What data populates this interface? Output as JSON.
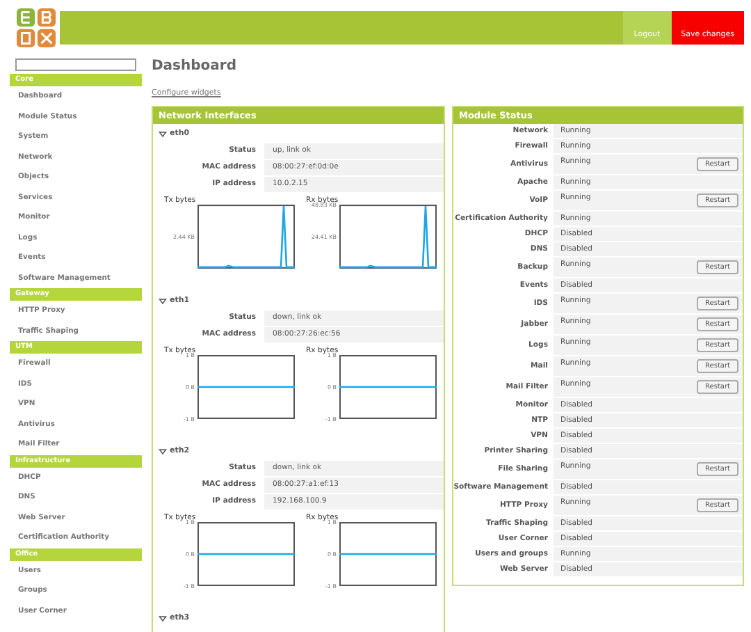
{
  "header": {
    "buttons": [
      {
        "label": "Logout",
        "kind": "plain"
      },
      {
        "label": "Save changes",
        "kind": "alert"
      }
    ]
  },
  "sidebar": {
    "sections": [
      {
        "title": "Core",
        "items": [
          "Dashboard",
          "Module Status",
          "System",
          "Network",
          "Objects",
          "Services",
          "Monitor",
          "Logs",
          "Events",
          "Software Management"
        ]
      },
      {
        "title": "Gateway",
        "items": [
          "HTTP Proxy",
          "Traffic Shaping"
        ]
      },
      {
        "title": "UTM",
        "items": [
          "Firewall",
          "IDS",
          "VPN",
          "Antivirus",
          "Mail Filter"
        ]
      },
      {
        "title": "Infrastructure",
        "items": [
          "DHCP",
          "DNS",
          "Web Server",
          "Certification Authority"
        ]
      },
      {
        "title": "Office",
        "items": [
          "Users",
          "Groups",
          "User Corner"
        ]
      }
    ]
  },
  "page": {
    "title": "Dashboard",
    "link": "Configure widgets"
  },
  "network": {
    "title": "Network Interfaces",
    "interfaces": [
      {
        "name": "eth0",
        "fields": [
          {
            "label": "Status",
            "value": "up, link ok"
          },
          {
            "label": "MAC address",
            "value": "08:00:27:ef:0d:0e"
          },
          {
            "label": "IP address",
            "value": "10.0.2.15"
          }
        ],
        "graphs": [
          {
            "title": "Tx bytes",
            "ticks": [
              "2.44 KB"
            ],
            "kind": "spike"
          },
          {
            "title": "Rx bytes",
            "ticks": [
              "48.83 KB",
              "24.41 KB"
            ],
            "kind": "spike"
          }
        ]
      },
      {
        "name": "eth1",
        "fields": [
          {
            "label": "Status",
            "value": "down, link ok"
          },
          {
            "label": "MAC address",
            "value": "08:00:27:26:ec:56"
          }
        ],
        "graphs": [
          {
            "title": "Tx bytes",
            "ticks": [
              "1 B",
              "0 B",
              "-1 B"
            ],
            "kind": "flat"
          },
          {
            "title": "Rx bytes",
            "ticks": [
              "1 B",
              "0 B",
              "-1 B"
            ],
            "kind": "flat"
          }
        ]
      },
      {
        "name": "eth2",
        "fields": [
          {
            "label": "Status",
            "value": "down, link ok"
          },
          {
            "label": "MAC address",
            "value": "08:00:27:a1:ef:13"
          },
          {
            "label": "IP address",
            "value": "192.168.100.9"
          }
        ],
        "graphs": [
          {
            "title": "Tx bytes",
            "ticks": [
              "1 B",
              "0 B",
              "-1 B"
            ],
            "kind": "flat"
          },
          {
            "title": "Rx bytes",
            "ticks": [
              "1 B",
              "0 B",
              "-1 B"
            ],
            "kind": "flat"
          }
        ]
      },
      {
        "name": "eth3"
      }
    ]
  },
  "modules": {
    "title": "Module Status",
    "rows": [
      {
        "name": "Network",
        "status": "Running"
      },
      {
        "name": "Firewall",
        "status": "Running"
      },
      {
        "name": "Antivirus",
        "status": "Running",
        "button": "Restart"
      },
      {
        "name": "Apache",
        "status": "Running"
      },
      {
        "name": "VoIP",
        "status": "Running",
        "button": "Restart"
      },
      {
        "name": "Certification Authority",
        "status": "Running"
      },
      {
        "name": "DHCP",
        "status": "Disabled"
      },
      {
        "name": "DNS",
        "status": "Disabled"
      },
      {
        "name": "Backup",
        "status": "Running",
        "button": "Restart"
      },
      {
        "name": "Events",
        "status": "Disabled"
      },
      {
        "name": "IDS",
        "status": "Running",
        "button": "Restart"
      },
      {
        "name": "Jabber",
        "status": "Running",
        "button": "Restart"
      },
      {
        "name": "Logs",
        "status": "Running",
        "button": "Restart"
      },
      {
        "name": "Mail",
        "status": "Running",
        "button": "Restart"
      },
      {
        "name": "Mail Filter",
        "status": "Running",
        "button": "Restart"
      },
      {
        "name": "Monitor",
        "status": "Disabled"
      },
      {
        "name": "NTP",
        "status": "Disabled"
      },
      {
        "name": "VPN",
        "status": "Disabled"
      },
      {
        "name": "Printer Sharing",
        "status": "Disabled"
      },
      {
        "name": "File Sharing",
        "status": "Running",
        "button": "Restart"
      },
      {
        "name": "Software Management",
        "status": "Disabled"
      },
      {
        "name": "HTTP Proxy",
        "status": "Running",
        "button": "Restart"
      },
      {
        "name": "Traffic Shaping",
        "status": "Disabled"
      },
      {
        "name": "User Corner",
        "status": "Disabled"
      },
      {
        "name": "Users and groups",
        "status": "Running"
      },
      {
        "name": "Web Server",
        "status": "Disabled"
      }
    ]
  }
}
